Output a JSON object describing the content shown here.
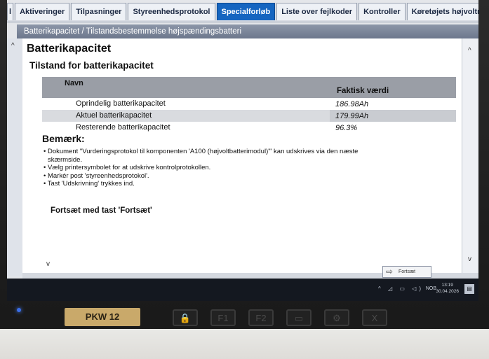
{
  "tabs": [
    {
      "label": "l",
      "active": false
    },
    {
      "label": "Aktiveringer",
      "active": false
    },
    {
      "label": "Tilpasninger",
      "active": false
    },
    {
      "label": "Styreenhedsprotokol",
      "active": false
    },
    {
      "label": "Specialforløb",
      "active": true
    },
    {
      "label": "Liste over fejlkoder",
      "active": false
    },
    {
      "label": "Kontroller",
      "active": false
    },
    {
      "label": "Køretøjets højvoltnet",
      "active": false
    }
  ],
  "breadcrumb": "Batterikapacitet / Tilstandsbestemmelse højspændingsbatteri",
  "page": {
    "title": "Batterikapacitet",
    "subtitle": "Tilstand for batterikapacitet"
  },
  "table": {
    "col_name": "Navn",
    "col_value": "Faktisk værdi",
    "rows": [
      {
        "name": "Oprindelig batterikapacitet",
        "value": "186.98Ah"
      },
      {
        "name": "Aktuel batterikapacitet",
        "value": "179.99Ah"
      },
      {
        "name": "Resterende batterikapacitet",
        "value": "96.3%"
      }
    ]
  },
  "note": {
    "heading": "Bemærk:",
    "lines": [
      "• Dokument \"Vurderingsprotokol til komponenten 'A100 (højvoltbatterimodul)'\" kan udskrives via den næste",
      "  skærmside.",
      "• Vælg printersymbolet for at udskrive kontrolprotokollen.",
      "• Markér post 'styreenhedsprotokol'.",
      "• Tast 'Udskrivning' trykkes ind."
    ]
  },
  "continue_text": "Fortsæt med tast 'Fortsæt'",
  "next_button": {
    "label": "Fortsæt",
    "icon": "arrow-right-icon"
  },
  "taskbar": {
    "tray_icons": [
      "chevron-up-icon",
      "network-icon",
      "battery-icon",
      "volume-icon"
    ],
    "language": "NOB",
    "time": "13:19",
    "date": "30.04.2026"
  },
  "hardware": {
    "badge": "PKW 12",
    "keys": [
      "lock-icon",
      "F1",
      "F2",
      "keyboard-icon",
      "settings-icon",
      "close-icon"
    ]
  },
  "colors": {
    "active_tab": "#1565c0",
    "crumb": "#7c869a"
  }
}
